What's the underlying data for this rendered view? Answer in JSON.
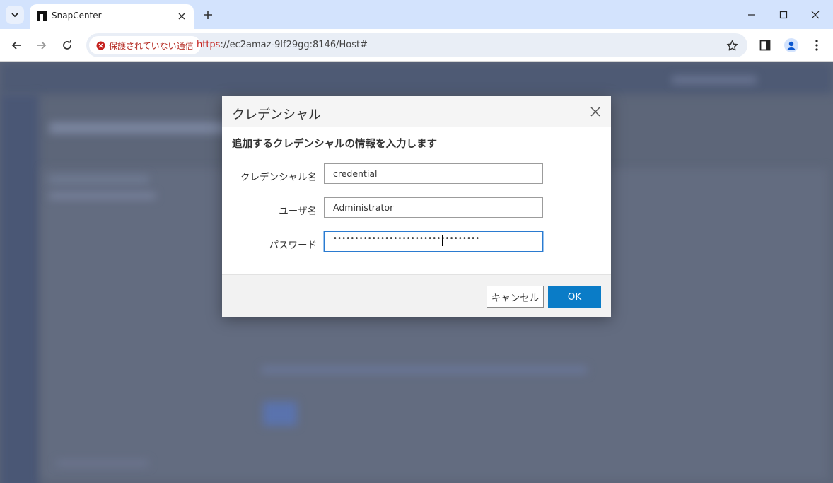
{
  "browser": {
    "tab_title": "SnapCenter",
    "security_label": "保護されていない通信",
    "url_scheme": "https",
    "url_rest": "://ec2amaz-9lf29gg:8146/Host#",
    "icons": [
      "tab-search-icon",
      "favicon",
      "close-icon",
      "plus-icon",
      "minimize-icon",
      "maximize-icon",
      "close-window-icon",
      "back-icon",
      "forward-icon",
      "reload-icon",
      "warning-icon",
      "star-icon",
      "side-panel-icon",
      "profile-icon",
      "menu-icon"
    ]
  },
  "dialog": {
    "title": "クレデンシャル",
    "subtitle": "追加するクレデンシャルの情報を入力します",
    "fields": [
      {
        "label": "クレデンシャル名",
        "value": "credential"
      },
      {
        "label": "ユーザ名",
        "value": "Administrator"
      },
      {
        "label": "パスワード",
        "masked_value": "••••••••••••••••••••••••••••••••••"
      }
    ],
    "cancel_label": "キャンセル",
    "ok_label": "OK"
  },
  "colors": {
    "tabbar_bg": "#d3e3fd",
    "overlay_bg": "#5d6679",
    "ok_button": "#0a7cc7",
    "insecure_red": "#b3261e",
    "focus_border": "#2b7bd0"
  }
}
